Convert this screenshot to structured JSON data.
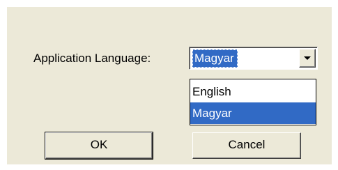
{
  "language_label": "Application Language:",
  "combo": {
    "selected_value": "Magyar"
  },
  "dropdown": {
    "options": [
      "English",
      "Magyar"
    ],
    "highlighted": "Magyar"
  },
  "buttons": {
    "ok_label": "OK",
    "cancel_label": "Cancel"
  },
  "colors": {
    "dialog_bg": "#ece9d8",
    "selection": "#316ac5"
  }
}
